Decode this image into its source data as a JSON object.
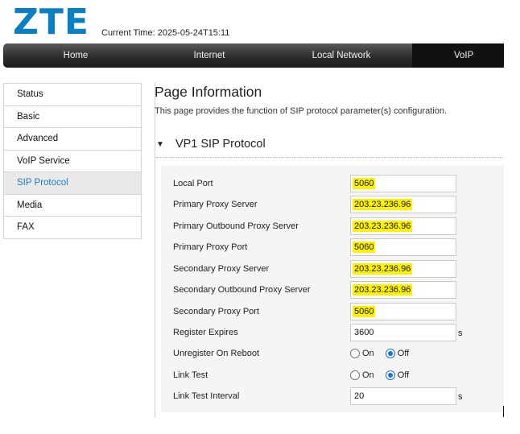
{
  "brand": {
    "logo_text": "ZTE",
    "color": "#0a7fc2"
  },
  "header": {
    "current_time_label": "Current Time:",
    "current_time_value": "2025-05-24T15:11"
  },
  "nav": {
    "tabs": [
      "Home",
      "Internet",
      "Local Network",
      "VoIP"
    ],
    "active": "VoIP"
  },
  "sidebar": {
    "items": [
      "Status",
      "Basic",
      "Advanced",
      "VoIP Service",
      "SIP Protocol",
      "Media",
      "FAX"
    ],
    "active": "SIP Protocol"
  },
  "page": {
    "title": "Page Information",
    "description": "This page provides the function of SIP protocol parameter(s) configuration."
  },
  "section": {
    "arrow": "▼",
    "title": "VP1 SIP Protocol"
  },
  "form": {
    "fields": [
      {
        "label": "Local Port",
        "value": "5060",
        "highlight": true
      },
      {
        "label": "Primary Proxy Server",
        "value": "203.23.236.96",
        "highlight": true
      },
      {
        "label": "Primary Outbound Proxy Server",
        "value": "203.23.236.96",
        "highlight": true
      },
      {
        "label": "Primary Proxy Port",
        "value": "5060",
        "highlight": true
      },
      {
        "label": "Secondary Proxy Server",
        "value": "203.23.236.96",
        "highlight": true
      },
      {
        "label": "Secondary Outbound Proxy Server",
        "value": "203.23.236.96",
        "highlight": true
      },
      {
        "label": "Secondary Proxy Port",
        "value": "5060",
        "highlight": true
      },
      {
        "label": "Register Expires",
        "value": "3600",
        "unit": "s"
      },
      {
        "label": "Unregister On Reboot",
        "options": [
          "On",
          "Off"
        ],
        "selected": "Off"
      },
      {
        "label": "Link Test",
        "options": [
          "On",
          "Off"
        ],
        "selected": "Off"
      },
      {
        "label": "Link Test Interval",
        "value": "20",
        "unit": "s"
      }
    ]
  },
  "colors": {
    "highlight": "#fff200",
    "active_link": "#1f7dbf",
    "radio_checked": "#1a73d4"
  }
}
